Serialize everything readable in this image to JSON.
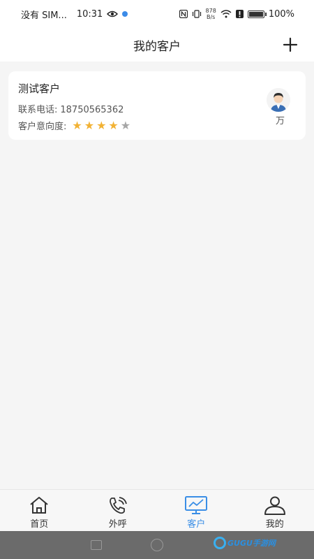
{
  "status_bar": {
    "carrier": "没有 SIM...",
    "time": "10:31",
    "net_speed_value": "878",
    "net_speed_unit": "B/s",
    "battery": "100%"
  },
  "header": {
    "title": "我的客户",
    "add_icon": "plus-icon"
  },
  "customers": [
    {
      "name": "测试客户",
      "phone_label": "联系电话:",
      "phone": "18750565362",
      "intent_label": "客户意向度:",
      "rating": 4,
      "rating_max": 5,
      "avatar_icon": "user-avatar-icon",
      "owner": "万"
    }
  ],
  "tabs": [
    {
      "label": "首页",
      "icon": "home-icon",
      "active": false
    },
    {
      "label": "外呼",
      "icon": "phone-icon",
      "active": false
    },
    {
      "label": "客户",
      "icon": "monitor-chart-icon",
      "active": true
    },
    {
      "label": "我的",
      "icon": "user-icon",
      "active": false
    }
  ],
  "colors": {
    "accent": "#3a8ee6",
    "star_on": "#f2b234",
    "star_off": "#a6a6a6"
  },
  "watermark": {
    "text": "GUGU手游网",
    "sub": "www.gugu5.com"
  }
}
